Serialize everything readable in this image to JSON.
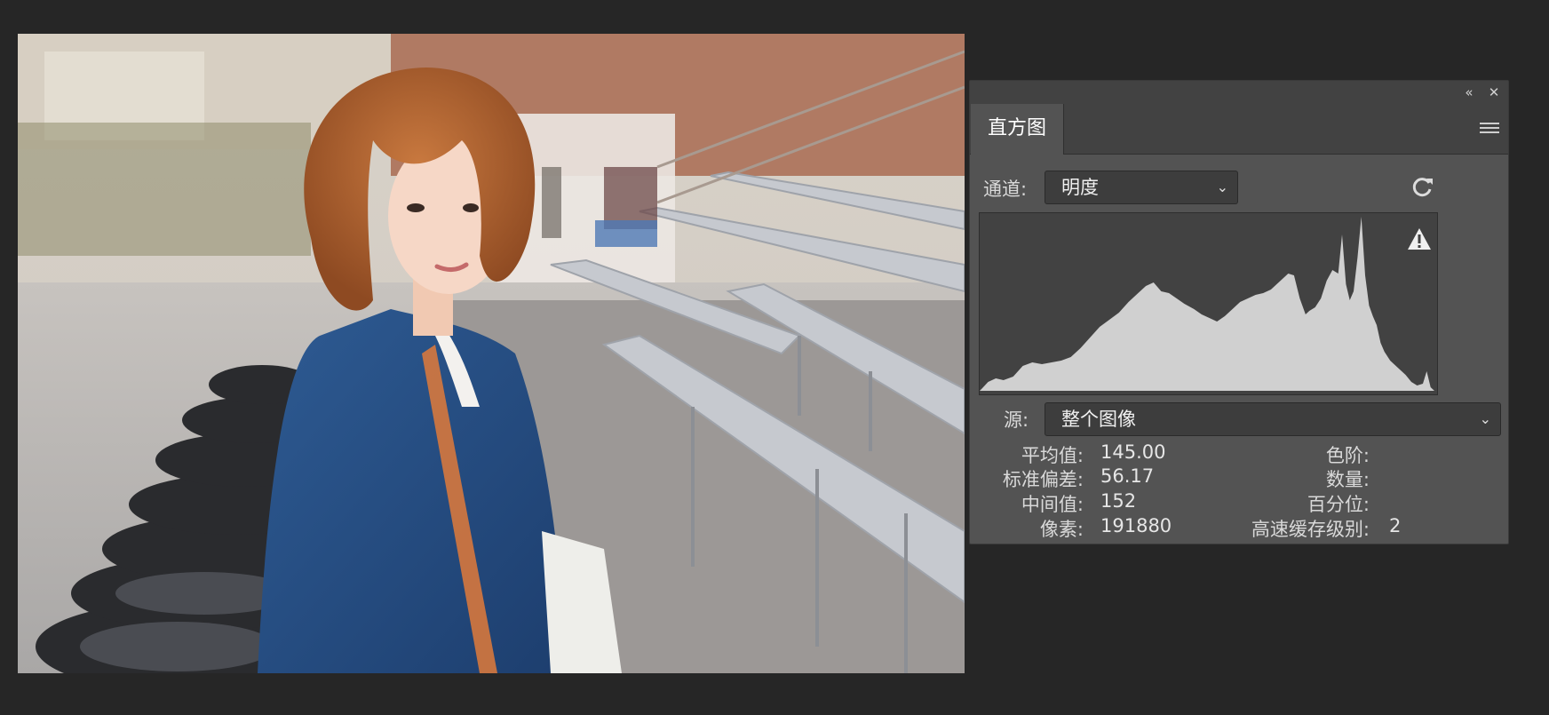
{
  "panel": {
    "tab_label": "直方图",
    "titlebar": {
      "collapse_icon": "double-chevron-left-icon",
      "close_icon": "close-icon"
    },
    "menu_icon": "hamburger-menu-icon",
    "channel": {
      "label": "通道:",
      "value": "明度"
    },
    "refresh_icon": "refresh-icon",
    "warning_icon": "cached-data-warning-icon",
    "source": {
      "label": "源:",
      "value": "整个图像"
    },
    "stats": {
      "mean_label": "平均值:",
      "mean_value": "145.00",
      "stddev_label": "标准偏差:",
      "stddev_value": "56.17",
      "median_label": "中间值:",
      "median_value": "152",
      "pixels_label": "像素:",
      "pixels_value": "191880",
      "level_label": "色阶:",
      "level_value": "",
      "count_label": "数量:",
      "count_value": "",
      "percentile_label": "百分位:",
      "percentile_value": "",
      "cache_label": "高速缓存级别:",
      "cache_value": "2"
    }
  },
  "colors": {
    "background": "#262626",
    "panel": "#535353",
    "histogram_bg": "#424242",
    "histogram_fill": "#d0d0d0"
  }
}
